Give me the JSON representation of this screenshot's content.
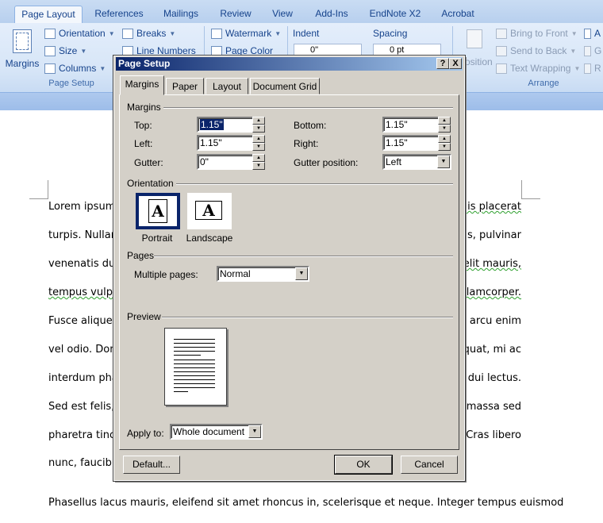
{
  "ribbon": {
    "tabs": [
      "Page Layout",
      "References",
      "Mailings",
      "Review",
      "View",
      "Add-Ins",
      "EndNote X2",
      "Acrobat"
    ],
    "active_tab": "Page Layout",
    "page_setup_group": {
      "label": "Page Setup",
      "margins_label": "Margins",
      "orientation": "Orientation",
      "size": "Size",
      "columns": "Columns",
      "breaks": "Breaks",
      "line_numbers": "Line Numbers"
    },
    "background_group": {
      "watermark": "Watermark",
      "page_color": "Page Color"
    },
    "paragraph_group": {
      "indent": "Indent",
      "spacing": "Spacing",
      "indent_value": "0\"",
      "spacing_value": "0 pt"
    },
    "arrange_group": {
      "label": "Arrange",
      "position": "Position",
      "bring_to_front": "Bring to Front",
      "send_to_back": "Send to Back",
      "text_wrapping": "Text Wrapping",
      "align_short": "A",
      "group_short": "G",
      "rotate_short": "R"
    }
  },
  "document": {
    "lines": [
      {
        "left": "Lorem ipsum",
        "right": "quis placerat"
      },
      {
        "left": "turpis.  Nullar",
        "right": "us,  pulvinar"
      },
      {
        "left": "venenatis dui",
        "right": "s elit mauris,"
      },
      {
        "left": "tempus vulpu",
        "right": "llamcorper."
      },
      {
        "left": "Fusce aliquet",
        "right": "r arcu enim"
      },
      {
        "left": "vel odio. Donc",
        "right": "equat, mi ac"
      },
      {
        "left": "interdum pha",
        "right": "s dui lectus."
      },
      {
        "left": "Sed  est  felis,",
        "right": "massa  sed"
      },
      {
        "left": "pharetra tinc",
        "right": "Cras libero"
      },
      {
        "left": "nunc, faucibu",
        "right": ""
      }
    ],
    "last_line": "Phasellus lacus mauris, eleifend sit amet rhoncus in, scelerisque et neque. Integer tempus euismod"
  },
  "dialog": {
    "title": "Page Setup",
    "help_button": "?",
    "close_button": "X",
    "tabs": [
      "Margins",
      "Paper",
      "Layout",
      "Document Grid"
    ],
    "active_tab": "Margins",
    "margins_section": "Margins",
    "top_label": "Top:",
    "top_value": "1.15\"",
    "bottom_label": "Bottom:",
    "bottom_value": "1.15\"",
    "left_label": "Left:",
    "left_value": "1.15\"",
    "right_label": "Right:",
    "right_value": "1.15\"",
    "gutter_label": "Gutter:",
    "gutter_value": "0\"",
    "gutter_position_label": "Gutter position:",
    "gutter_position_value": "Left",
    "orientation_section": "Orientation",
    "portrait_label": "Portrait",
    "landscape_label": "Landscape",
    "orientation_glyph": "A",
    "selected_orientation": "Portrait",
    "pages_section": "Pages",
    "multiple_pages_label": "Multiple pages:",
    "multiple_pages_value": "Normal",
    "preview_section": "Preview",
    "apply_to_label": "Apply to:",
    "apply_to_value": "Whole document",
    "default_button": "Default...",
    "ok_button": "OK",
    "cancel_button": "Cancel"
  }
}
